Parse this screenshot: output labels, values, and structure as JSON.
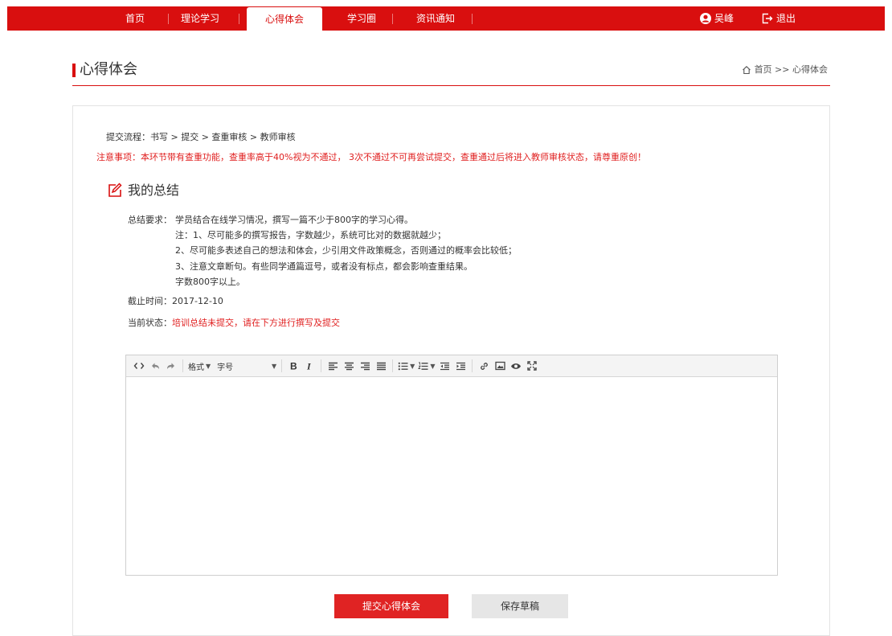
{
  "nav": {
    "items": [
      {
        "label": "首页",
        "active": false
      },
      {
        "label": "理论学习",
        "active": false
      },
      {
        "label": "心得体会",
        "active": true
      },
      {
        "label": "学习圈",
        "active": false
      },
      {
        "label": "资讯通知",
        "active": false
      }
    ],
    "user_name": "吴峰",
    "logout_label": "退出"
  },
  "page": {
    "title": "心得体会",
    "breadcrumb": "首页 >> 心得体会"
  },
  "flow": "提交流程：书写 > 提交 > 查重审核 > 教师审核",
  "notice": "注意事项：本环节带有查重功能，查重率高于40%视为不通过， 3次不通过不可再尝试提交，查重通过后将进入教师审核状态，请尊重原创！",
  "summary": {
    "title": "我的总结",
    "requirement_label": "总结要求：",
    "requirement_lines": [
      "学员结合在线学习情况，撰写一篇不少于800字的学习心得。",
      "注：1、尽可能多的撰写报告，字数越少，系统可比对的数据就越少；",
      "2、尽可能多表述自己的想法和体会，少引用文件政策概念，否则通过的概率会比较低；",
      "3、注意文章断句。有些同学通篇逗号，或者没有标点，都会影响查重结果。",
      "字数800字以上。"
    ],
    "deadline_label": "截止时间：",
    "deadline_value": "2017-12-10",
    "status_label": "当前状态：",
    "status_value": "培训总结未提交，请在下方进行撰写及提交"
  },
  "editor": {
    "format_label": "格式",
    "fontsize_label": "字号",
    "content": ""
  },
  "buttons": {
    "submit": "提交心得体会",
    "save_draft": "保存草稿"
  },
  "colors": {
    "brand_red": "#d90f0f",
    "notice_red": "#e02020"
  }
}
